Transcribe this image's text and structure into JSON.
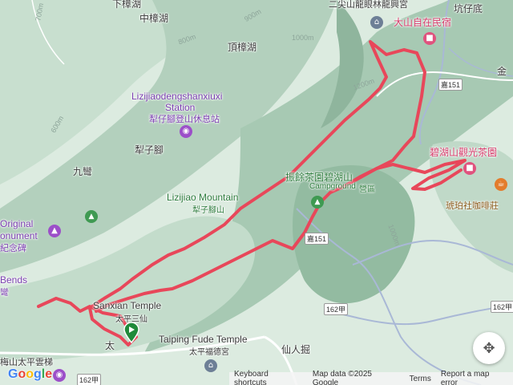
{
  "labels": {
    "xiazhanghu": "下樟湖",
    "zhongzhanghu": "中樟湖",
    "dingzhanghu": "頂樟湖",
    "station_en_1": "Lizijiaodengshanxiuxi",
    "station_en_2": "Station",
    "station_zh": "犁仔腳登山休息站",
    "lizijiao": "犁子腳",
    "jiuwan": "九彎",
    "mountain_en": "Lizijiao Mountain",
    "mountain_zh": "犁子腳山",
    "monument_1": "Original",
    "monument_2": "onument",
    "monument_3": "紀念碑",
    "bends": "Bends",
    "bends_zh": "彎",
    "temple_en": "Sanxian Temple",
    "temple_zh": "太平三仙",
    "fude_en": "Taiping Fude Temple",
    "fude_zh": "太平福德宮",
    "tai": "太",
    "xianrenjue": "仙人掘",
    "skybridge": "梅山太平雲梯",
    "dashan_top": "二尖山龍眼林龍興宮",
    "dashan": "大山自在民宿",
    "kengziding": "坑仔底",
    "jin": "金",
    "bihu_park": "碧湖山觀光茶園",
    "cafe": "琥珀社咖啡莊",
    "zhenyu": "振餘茶園碧湖山",
    "campground": "Campground",
    "campground_zh": "營區"
  },
  "contours": {
    "c900": "900m",
    "c800": "800m",
    "c1000": "1000m",
    "c1200": "1200m",
    "c600": "600m",
    "c1000b": "1000m",
    "c700": "700m"
  },
  "roads": {
    "r151a": "嘉151",
    "r151b": "嘉151",
    "r162a": "162甲",
    "r162b": "162甲",
    "r162c": "162甲"
  },
  "icons": {
    "camera_1": "camera-icon",
    "tent": "tent-icon",
    "monument": "monument-icon",
    "temple": "temple-icon",
    "hotel": "hotel-icon",
    "cafe": "coffee-icon",
    "start": "start-marker-icon",
    "compass": "compass-icon"
  },
  "attribution": {
    "shortcuts": "Keyboard shortcuts",
    "mapdata": "Map data ©2025 Google",
    "terms": "Terms",
    "report": "Report a map error"
  },
  "logo": {
    "g1": "G",
    "o1": "o",
    "o2": "o",
    "g2": "g",
    "l": "l",
    "e": "e"
  },
  "colors": {
    "track": "#e8475a",
    "terrain_light": "#dcebe0",
    "terrain_mid": "#b9d4c2",
    "terrain_dark": "#8fb59d",
    "road": "#a9b8d6"
  }
}
